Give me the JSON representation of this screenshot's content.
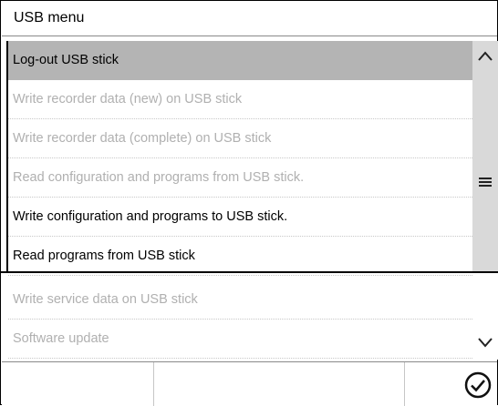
{
  "window": {
    "title": "USB menu"
  },
  "menu": {
    "items": [
      {
        "label": "Log-out USB stick",
        "state": "selected"
      },
      {
        "label": "Write recorder data (new) on USB stick",
        "state": "disabled"
      },
      {
        "label": "Write recorder data (complete) on USB stick",
        "state": "disabled"
      },
      {
        "label": "Read configuration and programs from USB stick.",
        "state": "disabled"
      },
      {
        "label": "Write configuration and programs to USB stick.",
        "state": "enabled"
      },
      {
        "label": "Read programs from USB stick",
        "state": "enabled"
      },
      {
        "label": "Write service data on USB stick",
        "state": "disabled"
      },
      {
        "label": "Software update",
        "state": "disabled"
      }
    ]
  },
  "scroll": {
    "up_icon": "chevron-up-icon",
    "middle_icon": "menu-icon",
    "down_icon": "chevron-down-icon"
  },
  "footer": {
    "confirm_icon": "checkmark-circle-icon"
  },
  "colors": {
    "selected_bg": "#b4b4b4",
    "disabled_text": "#b0b0b0",
    "track": "#d9d9d9"
  }
}
